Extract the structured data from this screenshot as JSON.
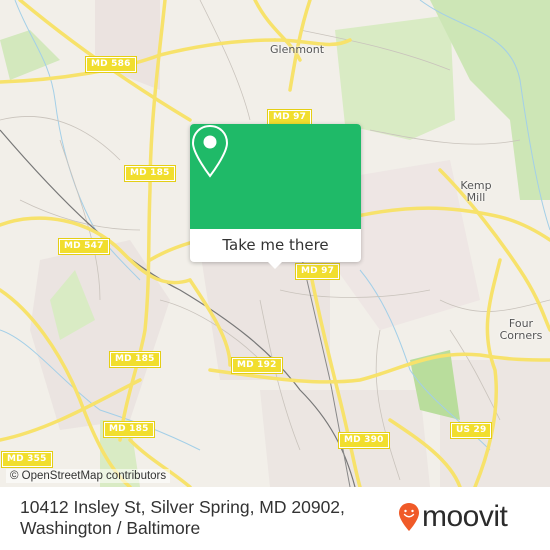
{
  "map": {
    "places": [
      {
        "name": "Glenmont"
      },
      {
        "name": "Kemp Mill"
      },
      {
        "name": "Four Corners"
      }
    ],
    "route_shields": [
      {
        "label": "MD 586"
      },
      {
        "label": "MD 97"
      },
      {
        "label": "MD 185"
      },
      {
        "label": "MD 547"
      },
      {
        "label": "MD 97"
      },
      {
        "label": "MD 185"
      },
      {
        "label": "MD 192"
      },
      {
        "label": "MD 185"
      },
      {
        "label": "MD 390"
      },
      {
        "label": "US 29"
      },
      {
        "label": "MD 355"
      }
    ],
    "attribution": "© OpenStreetMap contributors"
  },
  "popup": {
    "icon": "location-pin-icon",
    "button_label": "Take me there",
    "accent_color": "#1fba68"
  },
  "footer": {
    "address_line1": "10412 Insley St, Silver Spring, MD 20902,",
    "address_line2": "Washington / Baltimore",
    "logo_text": "moovit",
    "logo_color": "#f05a28"
  }
}
